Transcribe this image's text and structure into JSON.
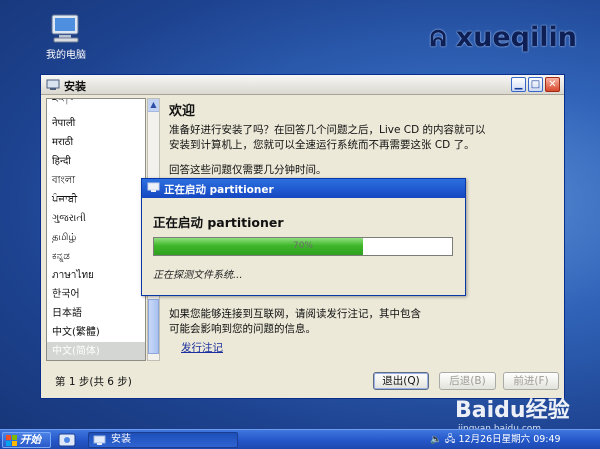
{
  "desktop": {
    "icon_label": "我的电脑",
    "brand": "xueqilin"
  },
  "window": {
    "title": "安装",
    "languages": [
      "ཇོང་ཁ",
      "नेपाली",
      "मराठी",
      "हिन्दी",
      "বাংলা",
      "ਪੰਜਾਬੀ",
      "ગુજરાતી",
      "தமிழ்",
      "ಕನ್ನಡ",
      "ภาษาไทย",
      "한국어",
      "日本語",
      "中文(繁體)",
      "中文(简体)"
    ],
    "selected_language": "中文(简体)",
    "heading": "欢迎",
    "paragraphs": [
      "准备好进行安装了吗？在回答几个问题之后，Live CD 的内容就可以",
      "安装到计算机上，您就可以全速运行系统而不再需要这张 CD 了。",
      "回答这些问题仅需要几分钟时间。",
      "如果您能够连接到互联网，请阅读发行注记，其中包含",
      "可能会影响到您的问题的信息。"
    ],
    "release_notes_link": "发行注记",
    "step_text": "第 1 步(共 6 步)",
    "buttons": {
      "quit": "退出(Q)",
      "back": "后退(B)",
      "forward": "前进(F)"
    }
  },
  "dialog": {
    "title": "正在启动 partitioner",
    "heading": "正在启动 partitioner",
    "progress_percent": 70,
    "progress_label": "70%",
    "status": "正在探测文件系统..."
  },
  "taskbar": {
    "start_label": "开始",
    "task_label": "安装",
    "clock": "12月26日星期六 09:49"
  },
  "watermark": {
    "main": "Baidu经验",
    "sub": "jingyan.baidu.com"
  },
  "colors": {
    "titlebar_active": "#1547c1",
    "progress_green": "#3fb72a",
    "desktop_blue": "#3063b8"
  }
}
